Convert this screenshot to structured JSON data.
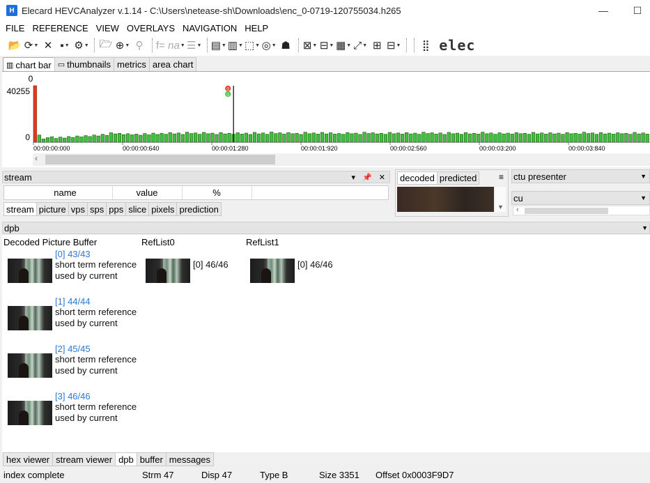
{
  "window": {
    "icon_text": "H",
    "title": "Elecard HEVCAnalyzer v.1.14 - C:\\Users\\netease-sh\\Downloads\\enc_0-0719-120755034.h265",
    "minimize": "—",
    "maximize": "☐"
  },
  "menu": [
    "FILE",
    "REFERENCE",
    "VIEW",
    "OVERLAYS",
    "NAVIGATION",
    "HELP"
  ],
  "toolbar": {
    "formula_label": "f=",
    "formula_value": "na",
    "brand": "elec"
  },
  "chart_tabs": [
    "chart bar",
    "thumbnails",
    "metrics",
    "area chart"
  ],
  "chart_data": {
    "type": "bar",
    "top_label": "0",
    "y_max_label": "40255",
    "y_min_label": "0",
    "ylim": [
      0,
      40255
    ],
    "x_ticks": [
      "00:00:00:000",
      "00:00:00:640",
      "00:00:01:280",
      "00:00:01:920",
      "00:00:02:560",
      "00:00:03:200",
      "00:00:03:840"
    ],
    "values": [
      40255,
      3800,
      1700,
      2400,
      2900,
      2000,
      2700,
      2200,
      3000,
      2500,
      3300,
      2800,
      3500,
      3000,
      3800,
      3300,
      4200,
      3600,
      5000,
      4400,
      4700,
      4000,
      4500,
      3900,
      4300,
      3700,
      4600,
      3900,
      4800,
      4100,
      4700,
      4200,
      5100,
      4400,
      4900,
      4100,
      5300,
      4600,
      4900,
      4200,
      5200,
      4500,
      4800,
      4100,
      5100,
      4400,
      4700,
      4200,
      5000,
      4300,
      4800,
      4100,
      5200,
      4400,
      4900,
      4200,
      5400,
      4600,
      5000,
      4300,
      5100,
      4500,
      4700,
      4100,
      5300,
      4500,
      4900,
      4300,
      5200,
      4400,
      5000,
      4300,
      4600,
      4200,
      5100,
      4500,
      4800,
      4100,
      5300,
      4600,
      5000,
      4400,
      4700,
      4200,
      5200,
      4500,
      4900,
      4300,
      5100,
      4400,
      4800,
      4200,
      5300,
      4600,
      5000,
      4300,
      4900,
      4100,
      5200,
      4500,
      4800,
      4200,
      5100,
      4400,
      4700,
      4300,
      5300,
      4500,
      4900,
      4200,
      5000,
      4400,
      4800,
      4300,
      5100,
      4500,
      4700,
      4200,
      5200,
      4400,
      4900,
      4300,
      5000,
      4400,
      4800,
      4200,
      5100,
      4500,
      4700,
      4300,
      5300,
      4600,
      4900,
      4200,
      5100,
      4400,
      4800,
      4300,
      5000,
      4500,
      4700,
      4200,
      5200,
      4400,
      4900,
      4300
    ],
    "series_colors": {
      "i_frame": "#e03a1e",
      "p_frame": "#3cc23c",
      "selected_marker": "#000000"
    },
    "selected_index": 47,
    "marker_labels": [
      "0",
      "0"
    ]
  },
  "stream_panel": {
    "title": "stream",
    "header_icons": [
      "▾",
      "📌",
      "✕"
    ],
    "columns": [
      "name",
      "value",
      "%"
    ],
    "tabs": [
      "stream",
      "picture",
      "vps",
      "sps",
      "pps",
      "slice",
      "pixels",
      "prediction"
    ]
  },
  "decoded_panel": {
    "tabs": [
      "decoded",
      "predicted"
    ],
    "menu_icon": "≡"
  },
  "ctu_panel": {
    "presenter": "ctu presenter",
    "cu": "cu"
  },
  "dpb": {
    "title": "dpb",
    "col_dpb": "Decoded Picture Buffer",
    "col_ref0": "RefList0",
    "col_ref1": "RefList1",
    "entries": [
      {
        "link": "[0] 43/43",
        "type": "short term reference",
        "usage": "used by current"
      },
      {
        "link": "[1] 44/44",
        "type": "short term reference",
        "usage": "used by current"
      },
      {
        "link": "[2] 45/45",
        "type": "short term reference",
        "usage": "used by current"
      },
      {
        "link": "[3] 46/46",
        "type": "short term reference",
        "usage": "used by current"
      }
    ],
    "ref0": "[0] 46/46",
    "ref1": "[0] 46/46"
  },
  "bottom_tabs": [
    "hex viewer",
    "stream viewer",
    "dpb",
    "buffer",
    "messages"
  ],
  "status": {
    "state": "index complete",
    "strm": "Strm 47",
    "disp": "Disp 47",
    "type": "Type B",
    "size": "Size 3351",
    "offset": "Offset 0x0003F9D7"
  }
}
